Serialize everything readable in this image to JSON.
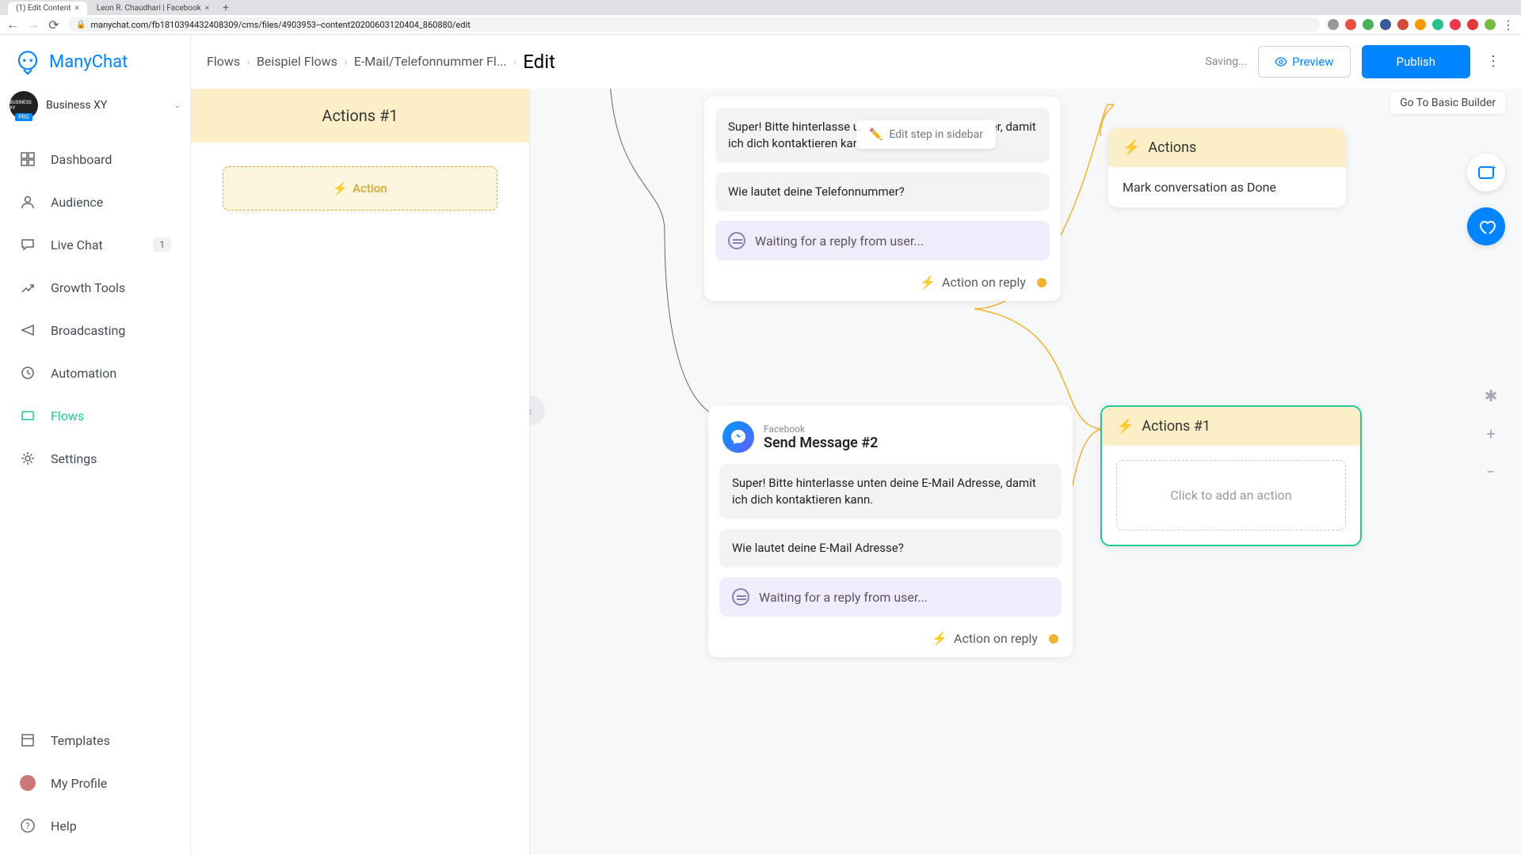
{
  "browser": {
    "tabs": [
      {
        "title": "(1) Edit Content",
        "active": true
      },
      {
        "title": "Leon R. Chaudhari | Facebook",
        "active": false
      }
    ],
    "url": "manychat.com/fb181039443240830­9/cms/files/4903953--content20200603120404_860880/edit"
  },
  "app": {
    "logo_text": "ManyChat",
    "account_name": "Business XY",
    "pro": "PRO"
  },
  "sidebar": {
    "items": [
      {
        "label": "Dashboard"
      },
      {
        "label": "Audience"
      },
      {
        "label": "Live Chat",
        "badge": "1"
      },
      {
        "label": "Growth Tools"
      },
      {
        "label": "Broadcasting"
      },
      {
        "label": "Automation"
      },
      {
        "label": "Flows",
        "active": true
      },
      {
        "label": "Settings"
      }
    ],
    "bottom": [
      {
        "label": "Templates"
      },
      {
        "label": "My Profile"
      },
      {
        "label": "Help"
      }
    ]
  },
  "header": {
    "crumbs": [
      "Flows",
      "Beispiel Flows",
      "E-Mail/Telefonnummer Fl..."
    ],
    "current": "Edit",
    "saving": "Saving...",
    "preview": "Preview",
    "publish": "Publish",
    "go_basic": "Go To Basic Builder"
  },
  "left_panel": {
    "title": "Actions #1",
    "add_label": "Action"
  },
  "canvas": {
    "tooltip": "Edit step in sidebar",
    "node1": {
      "msg1": "Super! Bitte hinterlasse unten deine Telefonnummer, damit ich dich kontaktieren kann.",
      "msg2": "Wie lautet deine Telefonnummer?",
      "waiting": "Waiting for a reply from user...",
      "action_reply": "Action on reply"
    },
    "node2": {
      "channel": "Facebook",
      "title": "Send Message #2",
      "msg1": "Super! Bitte hinterlasse unten deine E-Mail Adresse, damit ich dich kontaktieren kann.",
      "msg2": "Wie lautet deine E-Mail Adresse?",
      "waiting": "Waiting for a reply from user...",
      "action_reply": "Action on reply"
    },
    "actions_top": {
      "title": "Actions",
      "body": "Mark conversation as Done"
    },
    "actions_sel": {
      "title": "Actions #1",
      "body": "Click to add an action"
    }
  },
  "icons": {
    "bolt": "⚡"
  }
}
